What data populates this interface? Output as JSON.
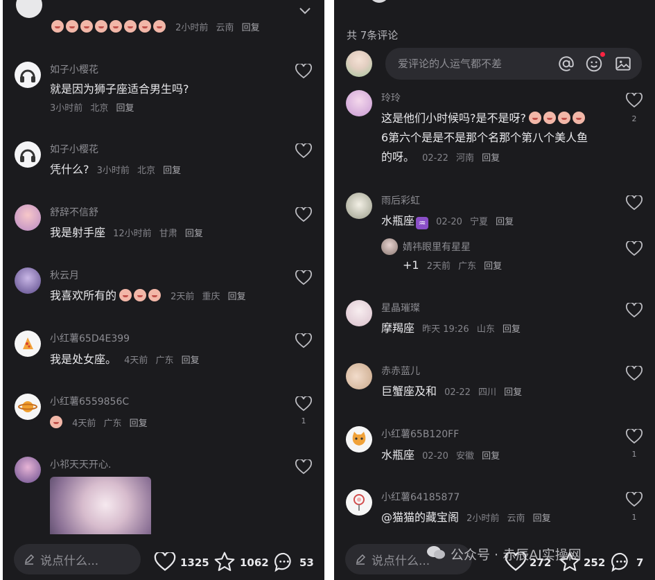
{
  "left": {
    "top_partial": {
      "meta": "2小时前",
      "location": "云南",
      "reply": "回复"
    },
    "comments": [
      {
        "user": "如子小樱花",
        "text": "就是因为狮子座适合男生吗?",
        "time": "3小时前",
        "location": "北京",
        "reply": "回复"
      },
      {
        "user": "如子小樱花",
        "text": "凭什么?",
        "time": "3小时前",
        "location": "北京",
        "reply": "回复"
      },
      {
        "user": "舒辞不信舒",
        "text": "我是射手座",
        "time": "12小时前",
        "location": "甘肃",
        "reply": "回复"
      },
      {
        "user": "秋云月",
        "text": "我喜欢所有的",
        "time": "2天前",
        "location": "重庆",
        "reply": "回复"
      },
      {
        "user": "小红薯65D4E399",
        "text": "我是处女座。",
        "time": "4天前",
        "location": "广东",
        "reply": "回复"
      },
      {
        "user": "小红薯6559856C",
        "text": "",
        "time": "4天前",
        "location": "广东",
        "reply": "回复",
        "likes": "1"
      },
      {
        "user": "小祁天天开心."
      }
    ],
    "bottom": {
      "placeholder": "说点什么...",
      "likes": "1325",
      "stars": "1062",
      "comments": "53"
    }
  },
  "right": {
    "count_label": "共 7条评论",
    "input_placeholder": "爱评论的人运气都不差",
    "comments": [
      {
        "user": "玲玲",
        "line1": "这是他们小时候吗?是不是呀?",
        "line2": "6第六个是是不是那个名那个第八个美人鱼",
        "line3": "的呀。",
        "time": "02-22",
        "location": "河南",
        "reply": "回复",
        "likes": "2"
      },
      {
        "user": "雨后彩虹",
        "text": "水瓶座",
        "time": "02-20",
        "location": "宁夏",
        "reply": "回复"
      },
      {
        "user": "婧祎眼里有星星",
        "text": "+1",
        "time": "2天前",
        "location": "广东",
        "reply": "回复"
      },
      {
        "user": "星晶璀璨",
        "text": "摩羯座",
        "time": "昨天 19:26",
        "location": "山东",
        "reply": "回复"
      },
      {
        "user": "赤赤蓝儿",
        "text": "巨蟹座及和",
        "time": "02-22",
        "location": "四川",
        "reply": "回复"
      },
      {
        "user": "小红薯65B120FF",
        "text": "水瓶座",
        "time": "02-20",
        "location": "安徽",
        "reply": "回复",
        "likes": "1"
      },
      {
        "user": "小红薯64185877",
        "text": "@猫猫的藏宝阁",
        "time": "2小时前",
        "location": "云南",
        "reply": "回复",
        "likes": "1"
      }
    ],
    "bottom": {
      "placeholder": "说点什么...",
      "likes": "272",
      "stars": "252",
      "comments": "7"
    },
    "watermark": "公众号 · 赤辰AI实操网"
  },
  "colors": {
    "panel_bg": "#1b1b1e",
    "text": "#e9e9ec",
    "muted": "#85858b",
    "unread_dot": "#ff2442"
  }
}
